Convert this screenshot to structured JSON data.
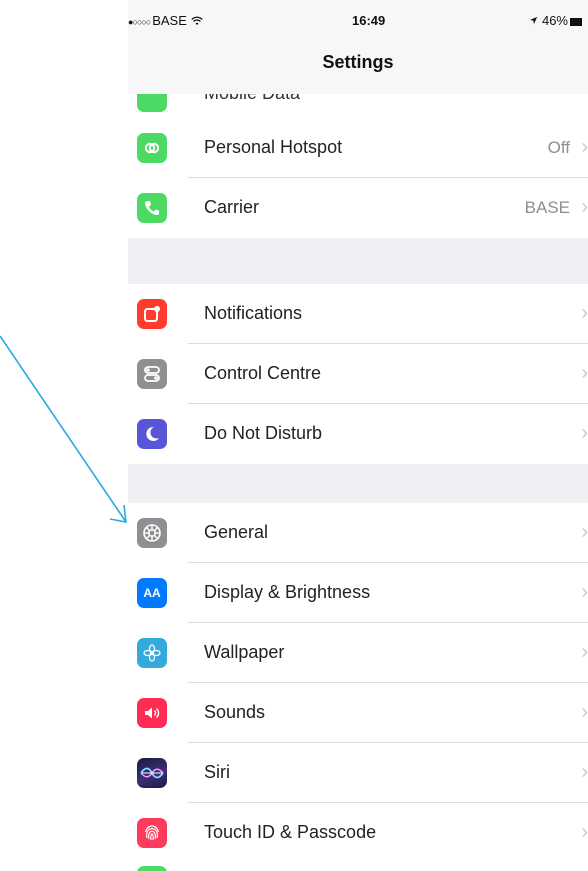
{
  "status_bar": {
    "signal_dots": "●○○○○",
    "carrier": "BASE",
    "wifi_icon": "wifi-icon",
    "time": "16:49",
    "location_icon": "location-arrow-icon",
    "battery": "46%"
  },
  "nav": {
    "title": "Settings"
  },
  "partial_top": {
    "label": "Mobile Data",
    "icon_color": "#4cd964"
  },
  "groups": [
    {
      "rows": [
        {
          "label": "Personal Hotspot",
          "value": "Off",
          "icon": "hotspot-icon",
          "color": "#4cd964",
          "chevron": "›"
        },
        {
          "label": "Carrier",
          "value": "BASE",
          "icon": "phone-icon",
          "color": "#4cd964",
          "chevron": "›"
        }
      ]
    },
    {
      "rows": [
        {
          "label": "Notifications",
          "value": "",
          "icon": "notifications-icon",
          "color": "#ff3b30",
          "chevron": "›"
        },
        {
          "label": "Control Centre",
          "value": "",
          "icon": "control-centre-icon",
          "color": "#8e8e93",
          "chevron": "›"
        },
        {
          "label": "Do Not Disturb",
          "value": "",
          "icon": "moon-icon",
          "color": "#5856d6",
          "chevron": "›"
        }
      ]
    },
    {
      "rows": [
        {
          "label": "General",
          "value": "",
          "icon": "gear-icon",
          "color": "#8e8e93",
          "chevron": "›"
        },
        {
          "label": "Display & Brightness",
          "value": "",
          "icon": "display-icon",
          "color": "#007aff",
          "chevron": "›",
          "glyph": "AA"
        },
        {
          "label": "Wallpaper",
          "value": "",
          "icon": "wallpaper-icon",
          "color": "#34aadc",
          "chevron": "›"
        },
        {
          "label": "Sounds",
          "value": "",
          "icon": "speaker-icon",
          "color": "#ff2d55",
          "chevron": "›"
        },
        {
          "label": "Siri",
          "value": "",
          "icon": "siri-icon",
          "color": "#1a1a3a",
          "chevron": "›"
        },
        {
          "label": "Touch ID & Passcode",
          "value": "",
          "icon": "fingerprint-icon",
          "color": "#ff3b5c",
          "chevron": "›"
        }
      ]
    }
  ],
  "annotation": {
    "color": "#29a9e1"
  }
}
